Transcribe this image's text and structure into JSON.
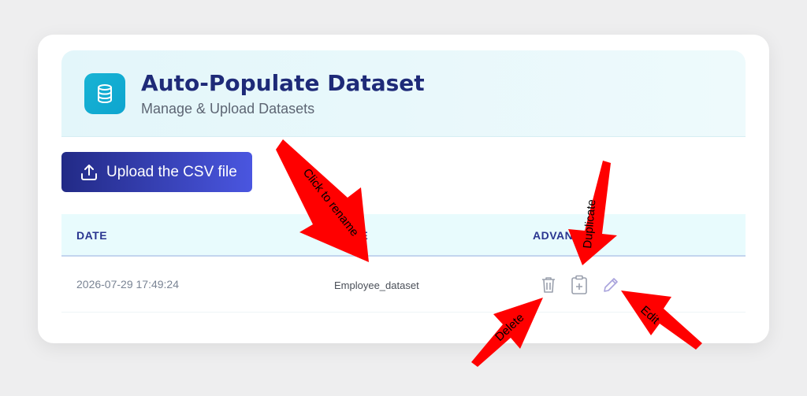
{
  "header": {
    "title": "Auto-Populate Dataset",
    "subtitle": "Manage & Upload Datasets",
    "logo_icon": "database-icon"
  },
  "toolbar": {
    "upload_label": "Upload the CSV file",
    "upload_icon": "upload-icon"
  },
  "table": {
    "columns": [
      "DATE",
      "NAME",
      "ADVANCED"
    ],
    "rows": [
      {
        "date": "2026-07-29 17:49:24",
        "name": "Employee_dataset",
        "actions": [
          "delete-icon",
          "duplicate-icon",
          "edit-icon"
        ]
      }
    ]
  },
  "annotations": {
    "rename": "Click to rename",
    "duplicate": "Duplicate",
    "delete": "Delete",
    "edit": "Edit",
    "arrow_color": "#ff0000"
  },
  "colors": {
    "accent": "#1e2a78",
    "button_start": "#222a86",
    "button_end": "#4a56e0",
    "logo": "#17b3d4"
  }
}
